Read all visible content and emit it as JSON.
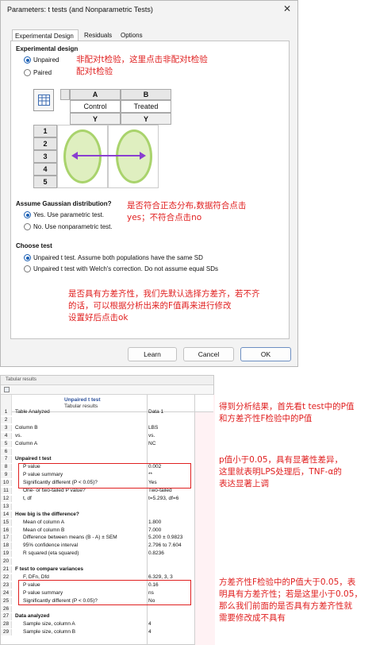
{
  "dialog": {
    "title": "Parameters: t tests (and Nonparametric Tests)",
    "tabs": [
      "Experimental Design",
      "Residuals",
      "Options"
    ],
    "experimental_design_title": "Experimental design",
    "design_options": [
      "Unpaired",
      "Paired"
    ],
    "grid": {
      "col_letters": [
        "A",
        "B"
      ],
      "col_names": [
        "Control",
        "Treated"
      ],
      "col_types": [
        "Y",
        "Y"
      ],
      "rows": [
        "1",
        "2",
        "3",
        "4",
        "5"
      ]
    },
    "gaussian_title": "Assume Gaussian distribution?",
    "gaussian_options": [
      "Yes. Use parametric test.",
      "No. Use nonparametric test."
    ],
    "choose_test_title": "Choose test",
    "test_options": [
      "Unpaired t test. Assume both populations have the same SD",
      "Unpaired t test with Welch's correction. Do not assume equal SDs"
    ],
    "buttons": {
      "learn": "Learn",
      "cancel": "Cancel",
      "ok": "OK"
    }
  },
  "annotations": {
    "unpaired_note_line1": "非配对t检验，这里点击非配对t检验",
    "unpaired_note_line2": "配对t检验",
    "gaussian_note_line1": "是否符合正态分布,数据符合点击",
    "gaussian_note_line2": "yes；不符合点击no",
    "variance_note_line1": "是否具有方差齐性，我们先默认选择方差齐，若不齐",
    "variance_note_line2": "的话，可以根据分析出来的F值再来进行修改",
    "variance_note_line3": "设置好后点击ok",
    "result_note_line1": "得到分析结果，首先看t test中的P值",
    "result_note_line2": "和方差齐性F检验中的P值",
    "pvalue_note_line1": "p值小于0.05，具有显著性差异，",
    "pvalue_note_line2": "这里就表明LPS处理后，TNF-α的",
    "pvalue_note_line3": "表达显著上调",
    "ftest_note_line1": "方差齐性F检验中的P值大于0.05，表",
    "ftest_note_line2": "明具有方差齐性；若是这里小于0.05，",
    "ftest_note_line3": "那么我们前面的是否具有方差齐性就",
    "ftest_note_line4": "需要修改成不具有"
  },
  "results": {
    "window_tab": "Tabular results",
    "header_title": "Unpaired t test",
    "header_subtitle": "Tabular results",
    "rows": [
      {
        "num": "1",
        "label": "Table Analyzed",
        "value": "Data 1"
      },
      {
        "num": "2",
        "label": "",
        "value": ""
      },
      {
        "num": "3",
        "label": "Column B",
        "value": "LBS"
      },
      {
        "num": "4",
        "label": "vs.",
        "value": "vs."
      },
      {
        "num": "5",
        "label": "Column A",
        "value": "NC"
      },
      {
        "num": "6",
        "label": "",
        "value": ""
      },
      {
        "num": "7",
        "label": "Unpaired t test",
        "value": ""
      },
      {
        "num": "8",
        "label": "P value",
        "value": "0.002"
      },
      {
        "num": "9",
        "label": "P value summary",
        "value": "**"
      },
      {
        "num": "10",
        "label": "Significantly different (P < 0.05)?",
        "value": "Yes"
      },
      {
        "num": "11",
        "label": "One- or two-tailed P value?",
        "value": "Two-tailed"
      },
      {
        "num": "12",
        "label": "t, df",
        "value": "t=5.293, df=6"
      },
      {
        "num": "13",
        "label": "",
        "value": ""
      },
      {
        "num": "14",
        "label": "How big is the difference?",
        "value": ""
      },
      {
        "num": "15",
        "label": "Mean of column A",
        "value": "1.800"
      },
      {
        "num": "16",
        "label": "Mean of column B",
        "value": "7.000"
      },
      {
        "num": "17",
        "label": "Difference between means (B - A) ± SEM",
        "value": "5.200 ± 0.9823"
      },
      {
        "num": "18",
        "label": "95% confidence interval",
        "value": "2.796 to 7.604"
      },
      {
        "num": "19",
        "label": "R squared (eta squared)",
        "value": "0.8236"
      },
      {
        "num": "20",
        "label": "",
        "value": ""
      },
      {
        "num": "21",
        "label": "F test to compare variances",
        "value": ""
      },
      {
        "num": "22",
        "label": "F, DFn, Dfd",
        "value": "6.329, 3, 3"
      },
      {
        "num": "23",
        "label": "P value",
        "value": "0.16"
      },
      {
        "num": "24",
        "label": "P value summary",
        "value": "ns"
      },
      {
        "num": "25",
        "label": "Significantly different (P < 0.05)?",
        "value": "No"
      },
      {
        "num": "26",
        "label": "",
        "value": ""
      },
      {
        "num": "27",
        "label": "Data analyzed",
        "value": ""
      },
      {
        "num": "28",
        "label": "Sample size, column A",
        "value": "4"
      },
      {
        "num": "29",
        "label": "Sample size, column B",
        "value": "4"
      }
    ]
  },
  "colors": {
    "annotation_red": "#e02020",
    "accent_blue": "#1a5fb4",
    "ellipse_green": "#a9d36c",
    "arrow_purple": "#8a3fd0"
  }
}
